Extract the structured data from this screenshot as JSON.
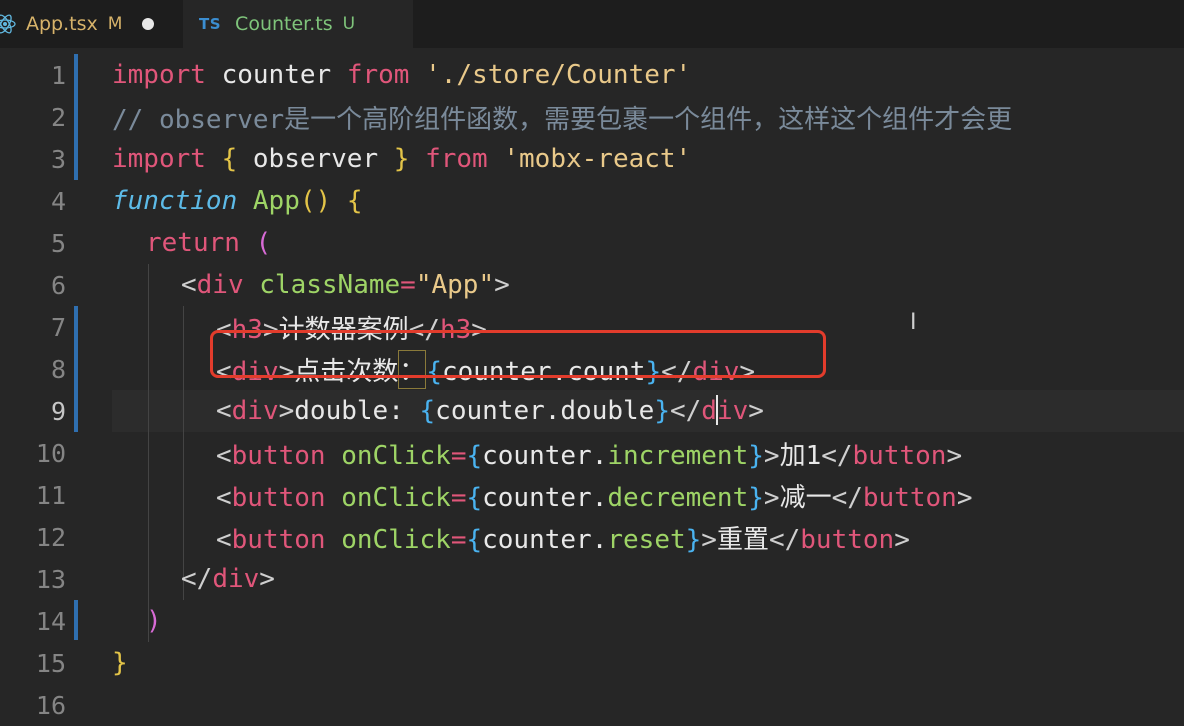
{
  "tabs": [
    {
      "name": "App.tsx",
      "status": "M",
      "icon": "react-icon",
      "modified_dot": true
    },
    {
      "name": "Counter.ts",
      "status": "U",
      "icon": "ts-icon",
      "icon_label": "TS"
    }
  ],
  "editor": {
    "line_numbers": [
      "1",
      "2",
      "3",
      "4",
      "5",
      "6",
      "7",
      "8",
      "9",
      "10",
      "11",
      "12",
      "13",
      "14",
      "15",
      "16"
    ],
    "lines": {
      "l1": {
        "kw": "import",
        "id": " counter ",
        "from": "from",
        "str": " './store/Counter'"
      },
      "l2": {
        "comment": "// observer是一个高阶组件函数，需要包裹一个组件，这样这个组件才会更"
      },
      "l3": {
        "kw": "import",
        "ob": " { ",
        "id": "observer",
        "cb": " } ",
        "from": "from",
        "str": " 'mobx-react'"
      },
      "l4": {
        "kw": "function",
        "fn": " App",
        "paren": "()",
        "brace": " {"
      },
      "l5": {
        "kw": "return",
        "paren": " ("
      },
      "l6": {
        "lt": "<",
        "tag": "div",
        "attr": " className",
        "eq": "=",
        "str": "\"App\"",
        "gt": ">"
      },
      "l7": {
        "lt": "<",
        "tag": "h3",
        "gt": ">",
        "text": "计数器案例",
        "close_lt": "</",
        "close_tag": "h3",
        "close_gt": ">"
      },
      "l8": {
        "lt": "<",
        "tag": "div",
        "gt": ">",
        "text": "点击次数",
        "colon": "：",
        "ob": "{",
        "expr": "counter.count",
        "cb": "}",
        "close_lt": "</",
        "close_tag": "div",
        "close_gt": ">"
      },
      "l9": {
        "lt": "<",
        "tag": "div",
        "gt": ">",
        "text": "double: ",
        "ob": "{",
        "expr": "counter.double",
        "cb": "}",
        "close_lt": "</",
        "close_tag": "div",
        "close_gt": ">"
      },
      "l10": {
        "lt": "<",
        "tag": "button",
        "attr": " onClick",
        "eq": "=",
        "ob": "{",
        "obj": "counter.",
        "prop": "increment",
        "cb": "}",
        "gt": ">",
        "text": "加1",
        "close_lt": "</",
        "close_tag": "button",
        "close_gt": ">"
      },
      "l11": {
        "lt": "<",
        "tag": "button",
        "attr": " onClick",
        "eq": "=",
        "ob": "{",
        "obj": "counter.",
        "prop": "decrement",
        "cb": "}",
        "gt": ">",
        "text": "减一",
        "close_lt": "</",
        "close_tag": "button",
        "close_gt": ">"
      },
      "l12": {
        "lt": "<",
        "tag": "button",
        "attr": " onClick",
        "eq": "=",
        "ob": "{",
        "obj": "counter.",
        "prop": "reset",
        "cb": "}",
        "gt": ">",
        "text": "重置",
        "close_lt": "</",
        "close_tag": "button",
        "close_gt": ">"
      },
      "l13": {
        "lt": "</",
        "tag": "div",
        "gt": ">"
      },
      "l14": {
        "paren": ")"
      },
      "l15": {
        "brace": "}"
      }
    }
  },
  "colors": {
    "highlight_border": "#e23c2c",
    "modified_gutter": "#2f6fb0",
    "keyword": "#e0567a",
    "string": "#e9c98a",
    "function": "#9ed466"
  }
}
